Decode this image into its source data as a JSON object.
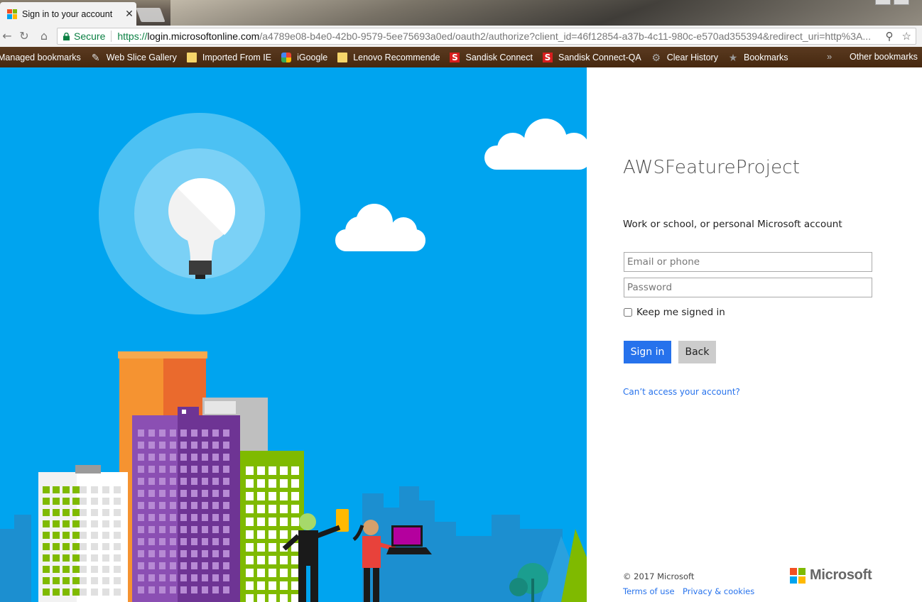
{
  "browser": {
    "tab_title": "Sign in to your account",
    "tab_close": "✕",
    "secure_label": "Secure",
    "url_scheme": "https://",
    "url_host": "login.microsoftonline.com",
    "url_rest": "/a4789e08-b4e0-42b0-9579-5ee75693a0ed/oauth2/authorize?client_id=46f12854-a37b-4c11-980c-e570ad355394&redirect_uri=http%3A...",
    "icons": {
      "back": "←",
      "reload": "↻",
      "home": "⌂",
      "pin": "⚲",
      "star": "☆"
    },
    "bookmarks": [
      {
        "label": "Managed bookmarks",
        "icon": "none"
      },
      {
        "label": "Web Slice Gallery",
        "icon": "web-slice"
      },
      {
        "label": "Imported From IE",
        "icon": "folder"
      },
      {
        "label": "iGoogle",
        "icon": "google"
      },
      {
        "label": "Lenovo Recommende",
        "icon": "folder"
      },
      {
        "label": "Sandisk Connect",
        "icon": "sandisk"
      },
      {
        "label": "Sandisk Connect-QA",
        "icon": "sandisk"
      },
      {
        "label": "Clear History",
        "icon": "gear"
      },
      {
        "label": "Bookmarks",
        "icon": "star"
      }
    ],
    "bookmarks_overflow": "»",
    "other_bookmarks": "Other bookmarks"
  },
  "signin": {
    "tenant": "AWSFeatureProject",
    "account_type": "Work or school, or personal Microsoft account",
    "email_placeholder": "Email or phone",
    "password_placeholder": "Password",
    "keep_signed_in": "Keep me signed in",
    "signin_button": "Sign in",
    "back_button": "Back",
    "cant_access": "Can’t access your account?",
    "copyright": "© 2017 Microsoft",
    "terms": "Terms of use",
    "privacy": "Privacy & cookies",
    "brand": "Microsoft"
  },
  "colors": {
    "accent_blue": "#2672ec",
    "illustration_sky": "#00a4ef",
    "ms_red": "#f25022",
    "ms_green": "#7fba00",
    "ms_blue": "#00a4ef",
    "ms_yellow": "#ffb900"
  }
}
